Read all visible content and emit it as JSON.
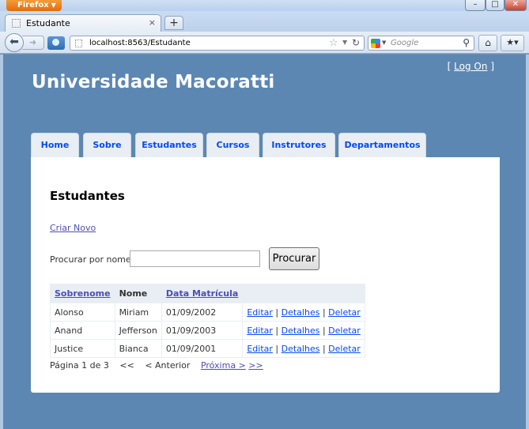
{
  "browser": {
    "app_button": "Firefox",
    "tab_title": "Estudante",
    "new_tab": "+",
    "url": "localhost:8563/Estudante",
    "search_placeholder": "Google"
  },
  "page": {
    "login_prefix": "[",
    "login_link": "Log On",
    "login_suffix": "]",
    "site_title": "Universidade Macoratti",
    "menu": [
      "Home",
      "Sobre",
      "Estudantes",
      "Cursos",
      "Instrutores",
      "Departamentos"
    ],
    "heading": "Estudantes",
    "create_link": "Criar Novo",
    "search_label": "Procurar por nome:",
    "search_value": "",
    "search_button": "Procurar",
    "table": {
      "headers": [
        "Sobrenome",
        "Nome",
        "Data Matrícula"
      ],
      "rows": [
        {
          "sobrenome": "Alonso",
          "nome": "Miriam",
          "data": "01/09/2002"
        },
        {
          "sobrenome": "Anand",
          "nome": "Jefferson",
          "data": "01/09/2003"
        },
        {
          "sobrenome": "Justice",
          "nome": "Bianca",
          "data": "01/09/2001"
        }
      ],
      "actions": [
        "Editar",
        "Detalhes",
        "Deletar"
      ],
      "action_separator": "|"
    },
    "pager": {
      "info": "Página 1 de 3",
      "first": "<<",
      "previous": "< Anterior",
      "next": "Próxima >",
      "last": ">>"
    }
  }
}
